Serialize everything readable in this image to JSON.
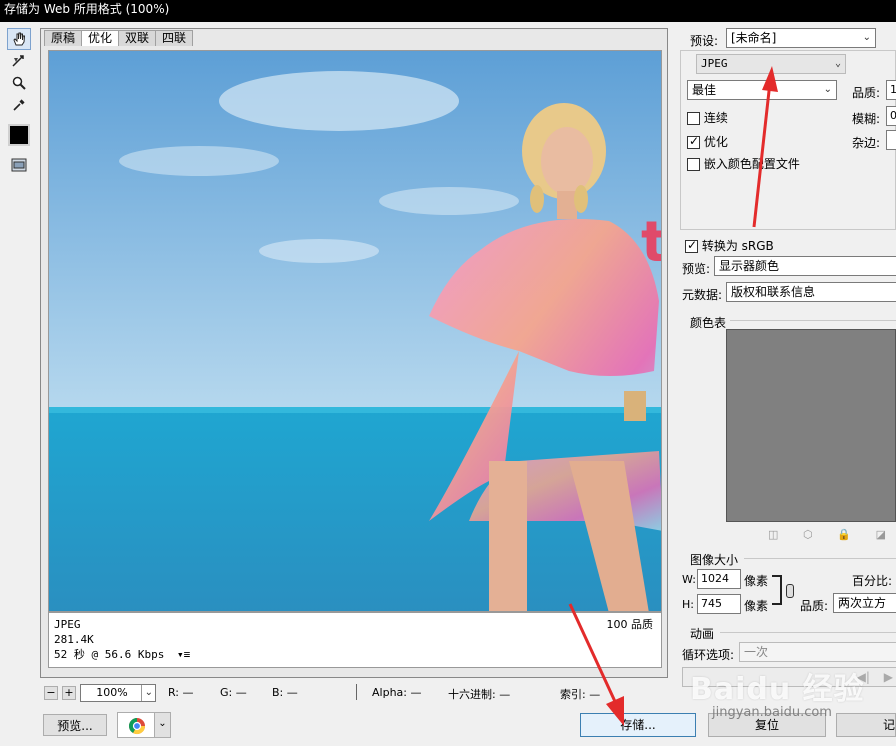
{
  "window": {
    "title": "存储为 Web 所用格式 (100%)"
  },
  "tools": {
    "items": [
      {
        "name": "hand-tool-icon",
        "glyph": "✋"
      },
      {
        "name": "slice-select-tool-icon",
        "glyph": "↗"
      },
      {
        "name": "zoom-tool-icon",
        "glyph": "🔍"
      },
      {
        "name": "eyedropper-tool-icon",
        "glyph": "✒"
      }
    ],
    "eyedropper_color": "#000000"
  },
  "preview": {
    "tabs": [
      "原稿",
      "优化",
      "双联",
      "四联"
    ],
    "active_tab": "优化",
    "image_accent_text": "t",
    "info": {
      "format": "JPEG",
      "size": "281.4K",
      "time": "52 秒 @ 56.6 Kbps",
      "time_menu": "▾≡",
      "quality": "100 品质"
    }
  },
  "statusbar": {
    "zoom": "100%",
    "r": "R: —",
    "g": "G: —",
    "b": "B: —",
    "alpha": "Alpha: —",
    "hex": "十六进制: —",
    "index": "索引: —"
  },
  "buttons": {
    "preview": "预览...",
    "save": "存储...",
    "reset": "复位",
    "remember": "记"
  },
  "settings": {
    "preset_label": "预设:",
    "preset_value": "[未命名]",
    "format": "JPEG",
    "quality_preset": "最佳",
    "quality_label": "品质:",
    "quality_value": "1",
    "blur_label": "模糊:",
    "blur_value": "0",
    "matte_label": "杂边:",
    "progressive": {
      "label": "连续",
      "checked": false
    },
    "optimized": {
      "label": "优化",
      "checked": true
    },
    "embed_profile": {
      "label": "嵌入颜色配置文件",
      "checked": false
    },
    "convert_srgb": {
      "label": "转换为 sRGB",
      "checked": true
    },
    "preview_label": "预览:",
    "preview_value": "显示器颜色",
    "metadata_label": "元数据:",
    "metadata_value": "版权和联系信息"
  },
  "color_table": {
    "title": "颜色表"
  },
  "image_size": {
    "title": "图像大小",
    "w_label": "W:",
    "w_value": "1024",
    "h_label": "H:",
    "h_value": "745",
    "unit": "像素",
    "percent_label": "百分比:",
    "quality_label": "品质:",
    "quality_value": "两次立方"
  },
  "animation": {
    "title": "动画",
    "loop_label": "循环选项:",
    "loop_value": "一次"
  },
  "watermark": {
    "brand": "Baidu 经验",
    "url": "jingyan.baidu.com"
  }
}
